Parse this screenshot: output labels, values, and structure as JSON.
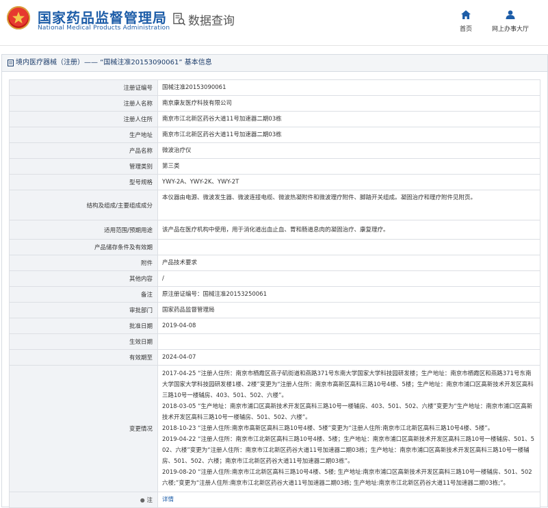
{
  "header": {
    "brand_cn": "国家药品监督管理局",
    "brand_en": "National Medical Products Administration",
    "query_label": "数据查询",
    "nav": [
      {
        "label": "首页",
        "icon": "home-icon"
      },
      {
        "label": "网上办事大厅",
        "icon": "user-icon"
      }
    ]
  },
  "panel": {
    "title": "境内医疗器械（注册）—— “国械注准20153090061” 基本信息"
  },
  "rows": [
    {
      "label": "注册证编号",
      "value": "国械注准20153090061"
    },
    {
      "label": "注册人名称",
      "value": "南京康友医疗科技有限公司"
    },
    {
      "label": "注册人住所",
      "value": "南京市江北新区药谷大道11号加速器二期03栋"
    },
    {
      "label": "生产地址",
      "value": "南京市江北新区药谷大道11号加速器二期03栋"
    },
    {
      "label": "产品名称",
      "value": "微波治疗仪"
    },
    {
      "label": "管理类别",
      "value": "第三类"
    },
    {
      "label": "型号规格",
      "value": "YWY-2A、YWY-2K、YWY-2T"
    },
    {
      "label": "结构及组成/主要组成成分",
      "value": "本仪器由电源、微波发生器、微波连接电缆、微波热凝附件和微波理疗附件、脚踏开关组成。凝固治疗和理疗附件见附页。"
    },
    {
      "label": "适用范围/预期用途",
      "value": "该产品在医疗机构中使用，用于消化道出血止血、胃和肠道息肉的凝固治疗、康复理疗。"
    },
    {
      "label": "产品储存条件及有效期",
      "value": ""
    },
    {
      "label": "附件",
      "value": "产品技术要求"
    },
    {
      "label": "其他内容",
      "value": "/"
    },
    {
      "label": "备注",
      "value": "原注册证编号：国械注准20153250061"
    },
    {
      "label": "审批部门",
      "value": "国家药品监督管理局"
    },
    {
      "label": "批准日期",
      "value": "2019-04-08"
    },
    {
      "label": "生效日期",
      "value": ""
    },
    {
      "label": "有效期至",
      "value": "2024-04-07"
    }
  ],
  "changes": {
    "label": "变更情况",
    "lines": [
      "2017-04-25 “注册人住所：南京市栖霞区燕子矶街道和燕路371号东南大学国家大学科技园研发楼；生产地址：南京市栖霞区和燕路371号东南大学国家大学科技园研发楼1楼、2楼”变更为“注册人住所：南京市高新区高科三路10号4楼、5楼；生产地址：南京市浦口区高新技术开发区高科三路10号一楼辅房、403、501、502、六楼”。",
      "2018-03-05 “生产地址：南京市浦口区高新技术开发区高科三路10号一楼辅房、403、501、502、六楼”变更为“生产地址：南京市浦口区高新技术开发区高科三路10号一楼辅房、501、502、六楼”。",
      "2018-10-23 “注册人住所:南京市高新区高科三路10号4楼、5楼”变更为“注册人住所:南京市江北新区高科三路10号4楼、5楼”。",
      "2019-04-22 “注册人住所：南京市江北新区高科三路10号4楼、5楼；生产地址：南京市浦口区高新技术开发区高科三路10号一楼辅房、501、502、六楼”变更为“注册人住所：南京市江北新区药谷大道11号加速器二期03栋；生产地址：南京市浦口区高新技术开发区高科三路10号一楼辅房、501、502、六楼；南京市江北新区药谷大道11号加速器二期03栋”。",
      "2019-08-20 “注册人住所:南京市江北新区高科三路10号4楼、5楼; 生产地址:南京市浦口区高新技术开发区高科三路10号一楼辅房、501、502六楼;”变更为“注册人住所:南京市江北新区药谷大道11号加速器二期03栋; 生产地址:南京市江北新区药谷大道11号加速器二期03栋;”。"
    ]
  },
  "note_row": {
    "label": "注",
    "link": "详情"
  }
}
